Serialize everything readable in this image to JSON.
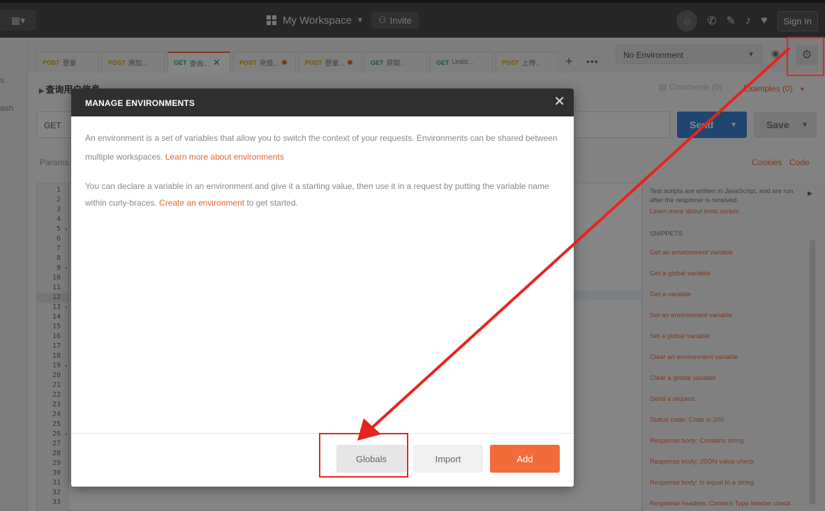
{
  "topbar": {
    "new_icon": "new-icon",
    "workspace_label": "My Workspace",
    "invite_label": "Invite",
    "sign_in_label": "Sign In"
  },
  "sidebar": {
    "fragments": [
      "s",
      "ash"
    ]
  },
  "tabs": [
    {
      "method": "POST",
      "label": "登录",
      "dirty": false,
      "active": false
    },
    {
      "method": "POST",
      "label": "添加...",
      "dirty": false,
      "active": false
    },
    {
      "method": "GET",
      "label": "查询...",
      "dirty": false,
      "active": true
    },
    {
      "method": "POST",
      "label": "充值...",
      "dirty": true,
      "active": false
    },
    {
      "method": "POST",
      "label": "登录...",
      "dirty": true,
      "active": false
    },
    {
      "method": "GET",
      "label": "获取...",
      "dirty": false,
      "active": false
    },
    {
      "method": "GET",
      "label": "Untiti...",
      "dirty": false,
      "active": false
    },
    {
      "method": "POST",
      "label": "上传...",
      "dirty": false,
      "active": false
    }
  ],
  "environment": {
    "selected": "No Environment"
  },
  "request": {
    "title": "查询用户信息",
    "comments_label": "Comments (0)",
    "examples_label": "Examples (0)",
    "method": "GET",
    "send_label": "Send",
    "save_label": "Save",
    "params_label": "Params",
    "cookies_label": "Cookies",
    "code_label": "Code"
  },
  "editor": {
    "line_count": 33,
    "fold_lines": [
      5,
      9,
      13,
      19,
      26
    ],
    "current_line": 12
  },
  "snippets": {
    "intro": "Test scripts are written in JavaScript, and are run after the response is received.",
    "learn_more": "Learn more about tests scripts",
    "heading": "SNIPPETS",
    "items": [
      "Get an environment variable",
      "Get a global variable",
      "Get a variable",
      "Set an environment variable",
      "Set a global variable",
      "Clear an environment variable",
      "Clear a global variable",
      "Send a request",
      "Status code: Code is 200",
      "Response body: Contains string",
      "Response body: JSON value check",
      "Response body: Is equal to a string",
      "Response headers: Content-Type header check"
    ]
  },
  "modal": {
    "title": "MANAGE ENVIRONMENTS",
    "p1_text": "An environment is a set of variables that allow you to switch the context of your requests. Environments can be shared between multiple workspaces.",
    "p1_link": "Learn more about environments",
    "p2_text_a": "You can declare a variable in an environment and give it a starting value, then use it in a request by putting the variable name within curly-braces.",
    "p2_link": "Create an environment",
    "p2_text_b": "to get started.",
    "globals_label": "Globals",
    "import_label": "Import",
    "add_label": "Add"
  },
  "colors": {
    "accent": "#f26b3a",
    "send_blue": "#3f84d6",
    "annotation_red": "#e8231c"
  }
}
